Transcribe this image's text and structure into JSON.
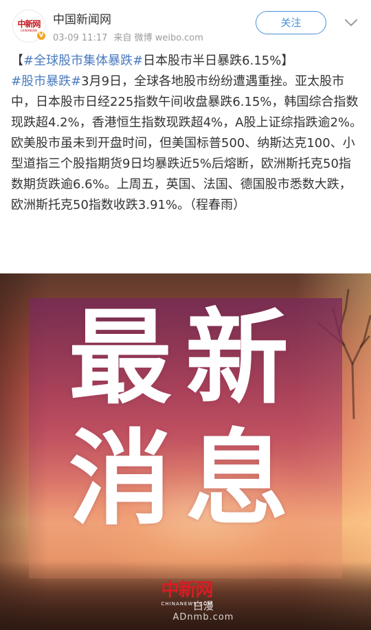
{
  "header": {
    "account_name": "中国新闻网",
    "avatar_logo": "中新网",
    "avatar_logo_sub": "CHINANEWS",
    "date": "03-09 11:17",
    "source": "来自 微博 weibo.com",
    "follow_label": "关注",
    "verified_badge": "V"
  },
  "post": {
    "paragraph": [
      {
        "type": "text",
        "value": "【"
      },
      {
        "type": "hashtag",
        "value": "#全球股市集体暴跌#"
      },
      {
        "type": "text",
        "value": "日本股市半日暴跌6.15%】"
      },
      {
        "type": "hashtag",
        "value": "#股市暴跌#"
      },
      {
        "type": "text",
        "value": "3月9日，全球各地股市纷纷遭遇重挫。亚太股市中，日本股市日经225指数午间收盘暴跌6.15%，韩国综合指数现跌超4.2%，香港恒生指数现跌超4%，A股上证综指跌逾2%。欧美股市虽未到开盘时间，但美国标普500、纳斯达克100、小型道指三个股指期货9日均暴跌近5%后熔断，欧洲斯托克50指数期货跌逾6.6%。上周五，英国、法国、德国股市悉数大跌，欧洲斯托克50指数收跌3.91%。（程春雨）"
      }
    ]
  },
  "image": {
    "headline_line1": "最新",
    "headline_line2": "消息",
    "logo": "中新网",
    "logo_sub": "CHINANEWS.COM",
    "watermark_top": "白漫",
    "watermark_url": "ADnmb.com"
  },
  "icons": {
    "more": "chevron-down-icon",
    "verified": "verified-badge-icon"
  },
  "colors": {
    "hashtag": "#4a7bbf",
    "follow": "#4a90d9",
    "brand_red": "#c4161c"
  }
}
